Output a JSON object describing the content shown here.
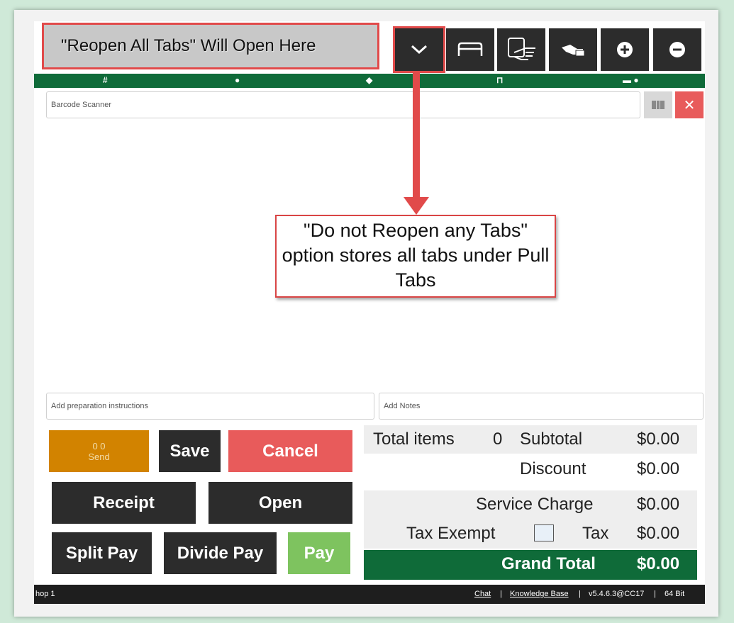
{
  "topbar": {
    "tab_field_text": "\"Reopen All Tabs\" Will Open Here",
    "buttons": [
      {
        "name": "chevron-down-icon",
        "glyph": "⌄"
      },
      {
        "name": "table-icon",
        "glyph": "⊓"
      },
      {
        "name": "hand-card-icon",
        "glyph": "☞"
      },
      {
        "name": "hand-pay-icon",
        "glyph": "✋"
      },
      {
        "name": "plus-circle-icon",
        "glyph": "+"
      },
      {
        "name": "minus-circle-icon",
        "glyph": "−"
      }
    ]
  },
  "greenbar": {
    "icons": [
      "hash-icon",
      "user-icon",
      "tag-icon",
      "table-icon",
      "wallet-user-icon"
    ],
    "glyphs": [
      "#",
      "●",
      "◆",
      "⊓",
      "▬ ●"
    ]
  },
  "barcode": {
    "placeholder": "Barcode Scanner"
  },
  "callout": {
    "text": "\"Do not Reopen any Tabs\" option stores all tabs under Pull Tabs"
  },
  "fields": {
    "prep_placeholder": "Add preparation instructions",
    "notes_placeholder": "Add Notes"
  },
  "actions": {
    "send_top": "0 0",
    "send_label": "Send",
    "save": "Save",
    "cancel": "Cancel",
    "receipt": "Receipt",
    "open": "Open",
    "split_pay": "Split Pay",
    "divide_pay": "Divide Pay",
    "pay": "Pay"
  },
  "summary": {
    "total_items_label": "Total items",
    "total_items_value": "0",
    "subtotal_label": "Subtotal",
    "subtotal_value": "$0.00",
    "discount_label": "Discount",
    "discount_value": "$0.00",
    "service_label": "Service Charge",
    "service_value": "$0.00",
    "tax_exempt_label": "Tax Exempt",
    "tax_label": "Tax",
    "tax_value": "$0.00",
    "grand_label": "Grand Total",
    "grand_value": "$0.00"
  },
  "status": {
    "left": "hop 1",
    "chat": "Chat",
    "sep1": "|",
    "kb": "Knowledge Base",
    "sep2": "|",
    "version": "v5.4.6.3@CC17",
    "sep3": "|",
    "bits": "64 Bit"
  },
  "colors": {
    "accent_red": "#e14a4a",
    "brand_green": "#0f6b39",
    "send_orange": "#d28300",
    "pay_green": "#7ec35f"
  }
}
